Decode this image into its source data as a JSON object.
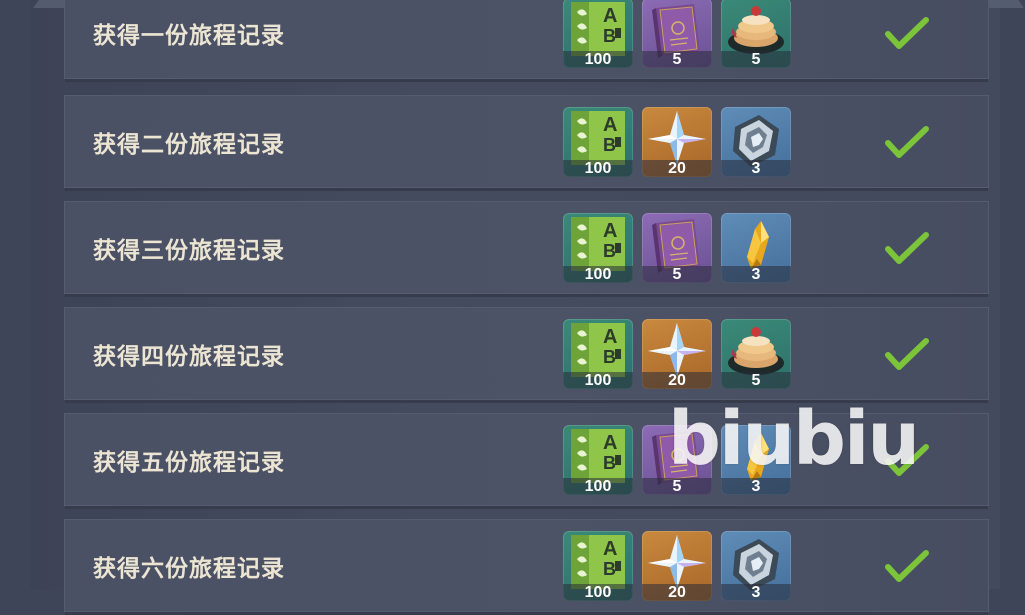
{
  "rows": [
    {
      "label": "获得一份旅程记录",
      "rewards": [
        {
          "icon": "adventure-exp-icon",
          "count": "100"
        },
        {
          "icon": "heros-wit-book-icon",
          "count": "5"
        },
        {
          "icon": "pancake-dish-icon",
          "count": "5"
        }
      ],
      "completed": true
    },
    {
      "label": "获得二份旅程记录",
      "rewards": [
        {
          "icon": "adventure-exp-icon",
          "count": "100"
        },
        {
          "icon": "primogem-icon",
          "count": "20"
        },
        {
          "icon": "mystic-enhancement-ore-icon",
          "count": "3"
        }
      ],
      "completed": true
    },
    {
      "label": "获得三份旅程记录",
      "rewards": [
        {
          "icon": "adventure-exp-icon",
          "count": "100"
        },
        {
          "icon": "heros-wit-book-icon",
          "count": "5"
        },
        {
          "icon": "golden-crystal-icon",
          "count": "3"
        }
      ],
      "completed": true
    },
    {
      "label": "获得四份旅程记录",
      "rewards": [
        {
          "icon": "adventure-exp-icon",
          "count": "100"
        },
        {
          "icon": "primogem-icon",
          "count": "20"
        },
        {
          "icon": "pancake-dish-icon",
          "count": "5"
        }
      ],
      "completed": true
    },
    {
      "label": "获得五份旅程记录",
      "rewards": [
        {
          "icon": "adventure-exp-icon",
          "count": "100"
        },
        {
          "icon": "heros-wit-book-icon",
          "count": "5"
        },
        {
          "icon": "golden-crystal-icon",
          "count": "3"
        }
      ],
      "completed": true
    },
    {
      "label": "获得六份旅程记录",
      "rewards": [
        {
          "icon": "adventure-exp-icon",
          "count": "100"
        },
        {
          "icon": "primogem-icon",
          "count": "20"
        },
        {
          "icon": "mystic-enhancement-ore-icon",
          "count": "3"
        }
      ],
      "completed": true
    }
  ],
  "watermark": "biubiu",
  "colors": {
    "check": "#7cc43a",
    "label": "#ece5d3",
    "row": "#4b5165"
  }
}
